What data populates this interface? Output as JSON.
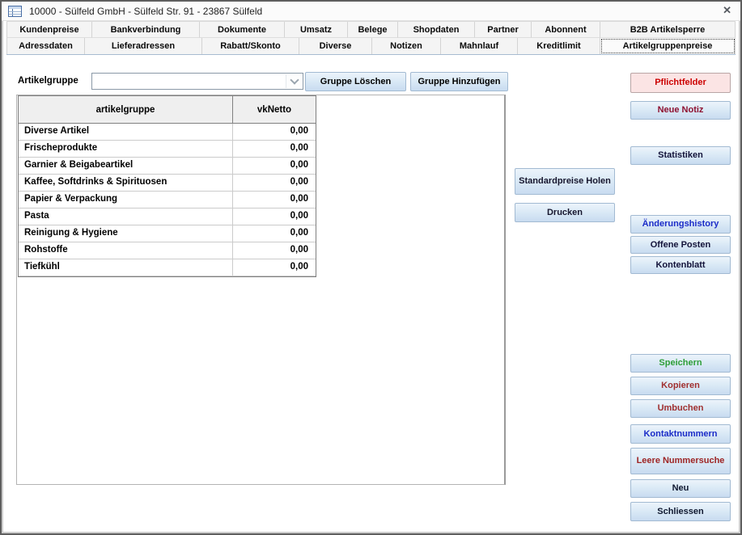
{
  "window": {
    "title": "10000 - Sülfeld GmbH - Sülfeld Str. 91 - 23867 Sülfeld",
    "close_glyph": "✕"
  },
  "tabs": {
    "row1": [
      {
        "label": "Kundenpreise"
      },
      {
        "label": "Bankverbindung"
      },
      {
        "label": "Dokumente"
      },
      {
        "label": "Umsatz"
      },
      {
        "label": "Belege"
      },
      {
        "label": "Shopdaten"
      },
      {
        "label": "Partner"
      },
      {
        "label": "Abonnent"
      },
      {
        "label": "B2B Artikelsperre"
      }
    ],
    "row2": [
      {
        "label": "Adressdaten"
      },
      {
        "label": "Lieferadressen"
      },
      {
        "label": "Rabatt/Skonto"
      },
      {
        "label": "Diverse"
      },
      {
        "label": "Notizen"
      },
      {
        "label": "Mahnlauf"
      },
      {
        "label": "Kreditlimit"
      },
      {
        "label": "Artikelgruppenpreise",
        "selected": true
      }
    ]
  },
  "toolbar": {
    "artikelgruppe_label": "Artikelgruppe",
    "combo_value": "",
    "delete_button": {
      "label": "Gruppe Löschen",
      "color": "#000000"
    },
    "add_button": {
      "label": "Gruppe Hinzufügen",
      "color": "#000000"
    }
  },
  "table": {
    "columns": [
      "artikelgruppe",
      "vkNetto"
    ],
    "rows": [
      {
        "name": "Diverse Artikel",
        "value": "0,00"
      },
      {
        "name": "Frischeprodukte",
        "value": "0,00"
      },
      {
        "name": "Garnier & Beigabeartikel",
        "value": "0,00"
      },
      {
        "name": "Kaffee, Softdrinks & Spirituosen",
        "value": "0,00"
      },
      {
        "name": "Papier & Verpackung",
        "value": "0,00"
      },
      {
        "name": "Pasta",
        "value": "0,00"
      },
      {
        "name": "Reinigung & Hygiene",
        "value": "0,00"
      },
      {
        "name": "Rohstoffe",
        "value": "0,00"
      },
      {
        "name": "Tiefkühl",
        "value": "0,00"
      }
    ]
  },
  "middle_panel": {
    "buttons": [
      {
        "label": "Standardpreise Holen",
        "color": "#16162e"
      },
      {
        "label": "Drucken",
        "color": "#16162e"
      }
    ]
  },
  "right_panel": {
    "buttons": [
      {
        "label": "Pflichtfelder",
        "color": "#cc0000",
        "background": "#fbe4e4",
        "border": "#b9a6a6"
      },
      {
        "label": "Neue Notiz",
        "color": "#8e1030"
      },
      {
        "label": "Statistiken",
        "color": "#13133a"
      },
      {
        "label": "Änderungshistory",
        "color": "#1b2cc8"
      },
      {
        "label": "Offene Posten",
        "color": "#13133a"
      },
      {
        "label": "Kontenblatt",
        "color": "#13133a"
      },
      {
        "label": "Speichern",
        "color": "#2e9e38"
      },
      {
        "label": "Kopieren",
        "color": "#a03030"
      },
      {
        "label": "Umbuchen",
        "color": "#a03030"
      },
      {
        "label": "Kontaktnummern",
        "color": "#1b2cc8"
      },
      {
        "label": "Leere Nummersuche",
        "color": "#9e2424"
      },
      {
        "label": "Neu",
        "color": "#0f1830"
      },
      {
        "label": "Schliessen",
        "color": "#0f1830"
      }
    ]
  },
  "colors": {
    "button_gradient_top": "#ecf4fb",
    "button_gradient_bottom": "#c8dbf0",
    "button_border": "#a2bad2",
    "tab_focus_outline": "#3a3a3a",
    "tabstrip_underline": "#a7bbd1"
  }
}
